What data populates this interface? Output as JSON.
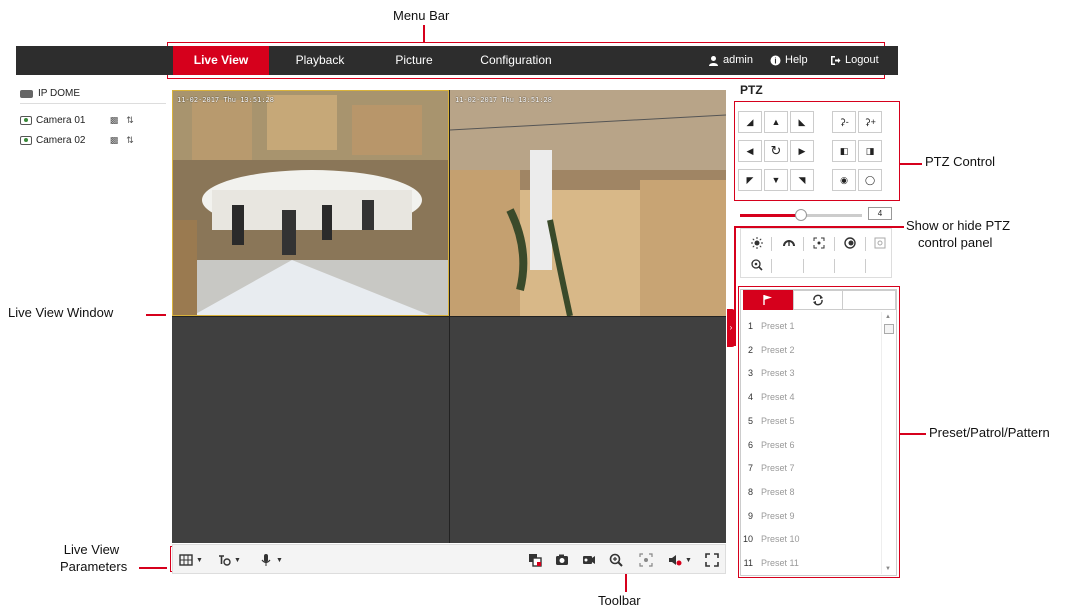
{
  "annotations": {
    "menu_bar": "Menu Bar",
    "ptz_control": "PTZ Control",
    "show_hide_ptz_line1": "Show or hide PTZ",
    "show_hide_ptz_line2": "control panel",
    "live_view_window": "Live View Window",
    "preset_patrol_pattern": "Preset/Patrol/Pattern",
    "live_view_params_line1": "Live View",
    "live_view_params_line2": "Parameters",
    "toolbar": "Toolbar"
  },
  "menu": {
    "tabs": [
      "Live View",
      "Playback",
      "Picture",
      "Configuration"
    ],
    "active_tab": "Live View",
    "user": "admin",
    "help": "Help",
    "logout": "Logout"
  },
  "tree": {
    "root": "IP DOME",
    "cameras": [
      "Camera 01",
      "Camera 02"
    ]
  },
  "live_view": {
    "pane1_osd": "11-02-2017 Thu 13:51:28",
    "pane2_osd": "11-02-2017 Thu 13:51:28"
  },
  "ptz": {
    "title": "PTZ",
    "speed": "4",
    "speed_fraction": 0.5
  },
  "presets": [
    {
      "num": "1",
      "name": "Preset 1"
    },
    {
      "num": "2",
      "name": "Preset 2"
    },
    {
      "num": "3",
      "name": "Preset 3"
    },
    {
      "num": "4",
      "name": "Preset 4"
    },
    {
      "num": "5",
      "name": "Preset 5"
    },
    {
      "num": "6",
      "name": "Preset 6"
    },
    {
      "num": "7",
      "name": "Preset 7"
    },
    {
      "num": "8",
      "name": "Preset 8"
    },
    {
      "num": "9",
      "name": "Preset 9"
    },
    {
      "num": "10",
      "name": "Preset 10"
    },
    {
      "num": "11",
      "name": "Preset 11"
    }
  ],
  "colors": {
    "accent": "#d6001c",
    "menubar": "#2d2d2d",
    "empty_pane": "#404040"
  }
}
